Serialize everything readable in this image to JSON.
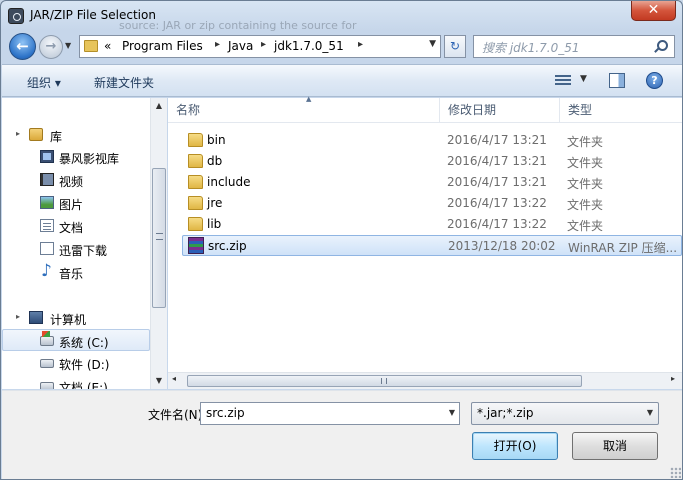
{
  "window": {
    "title": "JAR/ZIP File Selection",
    "ghost_text": "source: JAR or zip containing the source for",
    "close_symbol": "✕"
  },
  "nav": {
    "back_symbol": "←",
    "forward_symbol": "→",
    "history_symbol": "▼",
    "breadcrumb_prefix": "«",
    "breadcrumb": [
      "Program Files",
      "Java",
      "jdk1.7.0_51"
    ],
    "breadcrumb_sep": "▸",
    "dropdown_symbol": "▼",
    "refresh_symbol": "↻",
    "search_placeholder": "搜索 jdk1.7.0_51"
  },
  "commandbar": {
    "organize": "组织 ▾",
    "new_folder": "新建文件夹",
    "view_drop": "▼",
    "help": "?"
  },
  "sidebar": {
    "items": [
      {
        "label": "库",
        "icon": "library-icon"
      },
      {
        "label": "暴风影视库",
        "icon": "video-library-icon"
      },
      {
        "label": "视频",
        "icon": "film-icon"
      },
      {
        "label": "图片",
        "icon": "picture-icon"
      },
      {
        "label": "文档",
        "icon": "document-icon"
      },
      {
        "label": "迅雷下载",
        "icon": "download-icon"
      },
      {
        "label": "音乐",
        "icon": "music-icon"
      },
      {
        "label": "计算机",
        "icon": "computer-icon"
      },
      {
        "label": "系统 (C:)",
        "icon": "system-drive-icon"
      },
      {
        "label": "软件 (D:)",
        "icon": "drive-icon"
      },
      {
        "label": "文档 (E:)",
        "icon": "drive-icon"
      }
    ],
    "expand_symbol": "▸",
    "scroll_up": "▲",
    "scroll_down": "▼"
  },
  "filelist": {
    "columns": [
      "名称",
      "修改日期",
      "类型"
    ],
    "sort_arrow": "▲",
    "files": [
      {
        "name": "bin",
        "date": "2016/4/17 13:21",
        "type": "文件夹",
        "kind": "folder"
      },
      {
        "name": "db",
        "date": "2016/4/17 13:21",
        "type": "文件夹",
        "kind": "folder"
      },
      {
        "name": "include",
        "date": "2016/4/17 13:21",
        "type": "文件夹",
        "kind": "folder"
      },
      {
        "name": "jre",
        "date": "2016/4/17 13:22",
        "type": "文件夹",
        "kind": "folder"
      },
      {
        "name": "lib",
        "date": "2016/4/17 13:22",
        "type": "文件夹",
        "kind": "folder"
      },
      {
        "name": "src.zip",
        "date": "2013/12/18 20:02",
        "type": "WinRAR ZIP 压缩...",
        "kind": "zip",
        "selected": true
      }
    ],
    "scroll_left": "◂",
    "scroll_right": "▸"
  },
  "footer": {
    "filename_label": "文件名(N):",
    "filename_value": "src.zip",
    "filename_drop": "▼",
    "filter_value": "*.jar;*.zip",
    "filter_drop": "▼",
    "open_label": "打开(O)",
    "cancel_label": "取消"
  },
  "colors": {
    "selection_bg": "#cfe2f8",
    "accent": "#2c72c7",
    "close_red": "#c23a22"
  }
}
